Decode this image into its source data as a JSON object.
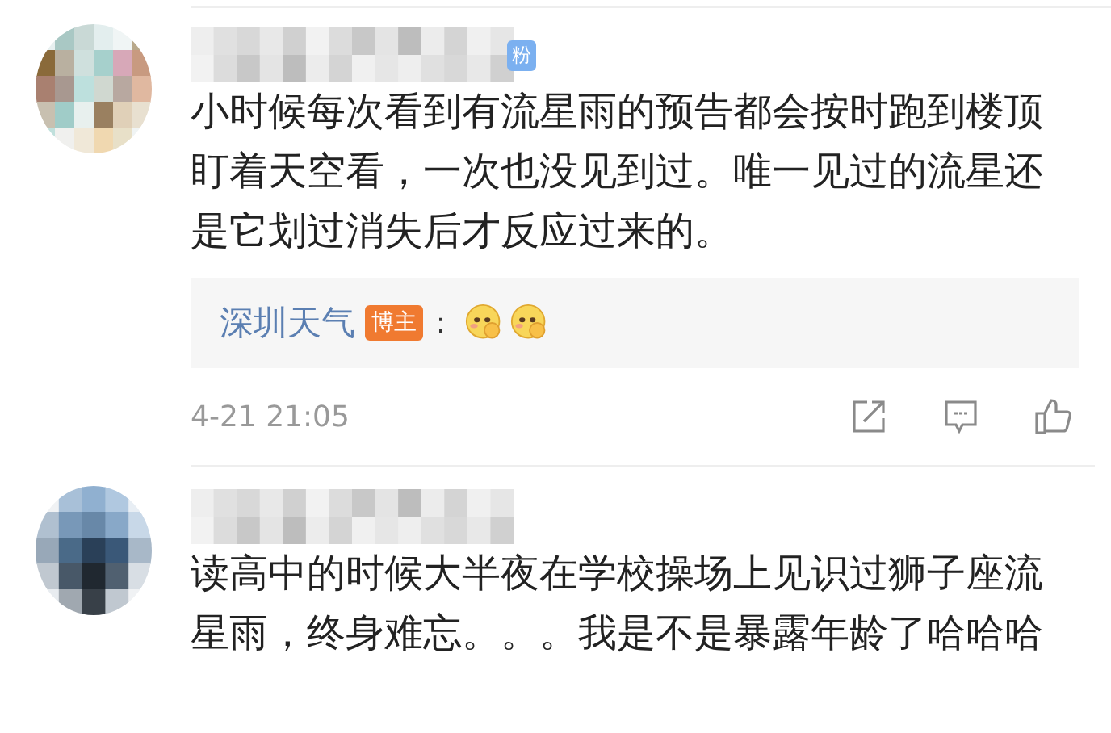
{
  "comments": [
    {
      "badge": "粉",
      "text": "小时候每次看到有流星雨的预告都会按时跑到楼顶盯着天空看，一次也没见到过。唯一见过的流星还是它划过消失后才反应过来的。",
      "reply": {
        "author": "深圳天气",
        "badge": "博主",
        "colon": "：",
        "emojis": [
          {
            "kind": "shy"
          },
          {
            "kind": "shy"
          }
        ]
      },
      "time": "4-21 21:05",
      "actions": [
        {
          "kind": "share"
        },
        {
          "kind": "comment"
        },
        {
          "kind": "like"
        }
      ]
    },
    {
      "text": "读高中的时候大半夜在学校操场上见识过狮子座流星雨，终身难忘。。。我是不是暴露年龄了哈哈哈"
    }
  ]
}
